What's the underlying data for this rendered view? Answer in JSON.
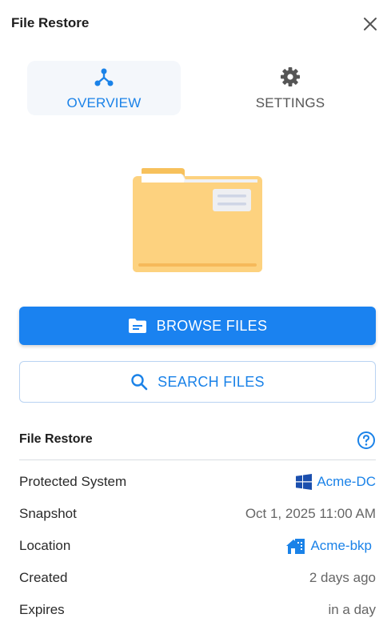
{
  "header": {
    "title": "File Restore"
  },
  "tabs": [
    {
      "label": "OVERVIEW",
      "icon": "hierarchy-icon",
      "active": true
    },
    {
      "label": "SETTINGS",
      "icon": "gear-icon",
      "active": false
    }
  ],
  "actions": {
    "browse_label": "BROWSE FILES",
    "search_label": "SEARCH FILES"
  },
  "details": {
    "title": "File Restore",
    "rows": [
      {
        "key": "Protected System",
        "value": "Acme-DC",
        "icon": "windows-icon"
      },
      {
        "key": "Snapshot",
        "value": "Oct 1, 2025 11:00 AM"
      },
      {
        "key": "Location",
        "value": "Acme-bkp",
        "icon": "building-icon"
      },
      {
        "key": "Created",
        "value": "2 days ago"
      },
      {
        "key": "Expires",
        "value": "in a day"
      }
    ]
  },
  "colors": {
    "accent": "#1a82f0",
    "folder": "#fdd27f",
    "link": "#1a82e8"
  }
}
